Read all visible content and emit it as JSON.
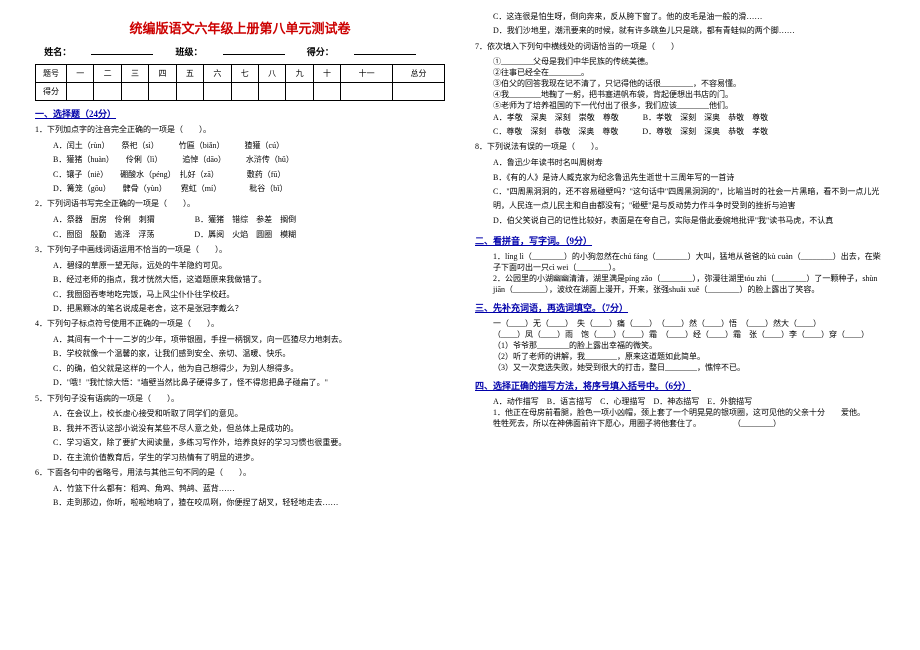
{
  "doc": {
    "title": "统编版语文六年级上册第八单元测试卷",
    "labels": {
      "name": "姓名：",
      "class": "班级：",
      "score": "得分："
    },
    "table": {
      "row1": [
        "题号",
        "一",
        "二",
        "三",
        "四",
        "五",
        "六",
        "七",
        "八",
        "九",
        "十",
        "十一",
        "总分"
      ],
      "row2_head": "得分"
    }
  },
  "s1": {
    "head": "一、选择题（24分）"
  },
  "q1": {
    "stem": "1．下列加点字的注音完全正确的一项是（　　）。",
    "a": "A．闰土（rùn）　　祭祀（sì）　　　竹匾（biǎn）　　　猹獾（cú）",
    "b": "B．獾猪（huàn）　　伶俐（lì）　　　追悼（dāo）　　　水浒传（hǔ）",
    "c": "C．镶子（niè）　　硼酸水（péng）　扎好（zā）　　　　敷药（fū）",
    "d": "D．篝笼（gōu）　　髀骨（yùn）　　 霓虹（mí）　　　　秕谷（bǐ）"
  },
  "q2": {
    "stem": "2．下列词语书写完全正确的一项是（　　）。",
    "a": "A．祭器　厨房　伶俐　刺猬",
    "b": "B．獾猪　错综　参差　搁倒",
    "c": "C．囫囵　殷勤　逃泽　浮荡",
    "d": "D．羼阅　火焰　圆圈　模糊"
  },
  "q3": {
    "stem": "3．下列句子中画线词语运用不恰当的一项是（　　）。",
    "a": "A．碧绿的草原一望无际，远处的牛羊隐约可见。",
    "b": "B．经过老师的指点，我才恍然大悟，这道题原来我做错了。",
    "c": "C．我囫囵吞枣地吃完饭，马上风尘仆仆往学校赶。",
    "d": "D．把黑颗冰的笔名说成是老舍，这不是张冠李戴么？"
  },
  "q4": {
    "stem": "4．下列句子标点符号使用不正确的一项是（　　）。",
    "a": "A．其间有一个十一二岁的少年，项带银圈，手捏一柄钢叉，向一匹猹尽力地刺去。",
    "b": "B．学校就像一个温馨的家，让我们感到安全、亲切、温暖、快乐。",
    "c": "C．的确，伯父就是这样的一个人，他为自己想得少，为别人想得多。",
    "d": "D．\"哦！\"我忙惊大悟：\"墙壁当然比鼻子硬得多了，怪不得您把鼻子碰扁了。\""
  },
  "q5": {
    "stem": "5．下列句子没有语病的一项是（　　）。",
    "a": "A．在会议上，校长虚心接受和听取了同学们的意见。",
    "b": "B．我并不否认这部小说没有某些不尽人意之处，但总体上是成功的。",
    "c": "C．学习语文，除了要扩大阅读量，多练习写作外，培养良好的学习习惯也很重要。",
    "d": "D．在主流价值教育后，学生的学习热情有了明显的进步。"
  },
  "q6": {
    "stem": "6．下面各句中的省略号，用法与其他三句不同的是（　　）。",
    "a": "A．竹篮下什么都有：稻鸡、角鸡、鹁鸪、蓝背……",
    "b": "B．走到那边，你听，啦啦地响了，猹在咬瓜咧，你便捏了胡叉，轻轻地走去……",
    "c": "C．这连很是怕生呀，倒向奔来，反从胯下窗了。他的皮毛是油一般的滑……",
    "d": "D．我们沙地里，潮汛要来的时候，就有许多跳鱼儿只是跳，都有青蛙似的两个脚……"
  },
  "q7": {
    "stem": "7．依次填入下列句中横线处的词语恰当的一项是（　　）",
    "l1": "①________父母是我们中华民族的传统美德。",
    "l2": "②往事已经全在________。",
    "l3": "③伯父的回答我现在记不清了，只记得他的话很________，不容易懂。",
    "l4": "④我________地鞠了一躬，把书塞进帆布袋，背起便想出书店的门。",
    "l5": "⑤老师为了培养祖国的下一代付出了很多，我们应该________他们。",
    "a": "A．孝敬　深奥　深刻　崇敬　尊敬",
    "b": "B．孝敬　深刻　深奥　恭敬　尊敬",
    "c": "C．尊敬　深刻　恭敬　深奥　尊敬",
    "d": "D．尊敬　深刻　深奥　恭敬　孝敬"
  },
  "q8": {
    "stem": "8．下列说法有误的一项是（　　）。",
    "a": "A．鲁迅少年读书时名叫周树寿",
    "b": "B．《有的人》是诗人臧克家为纪念鲁迅先生逝世十三周年写的一首诗",
    "c": "C．\"四周黑洞洞的，还不容易碰壁吗？\"这句话中\"四周黑洞洞的\"，比喻当时的社会一片黑暗，看不到一点儿光明，人民连一点儿民主和自由都没有；\"碰壁\"是与反动势力作斗争时受到的挫折与迫害",
    "d": "D．伯父笑说自己的记性比较好，表面是在夸自己，实际是借此委婉地批评\"我\"读书马虎，不认真"
  },
  "s2": {
    "head": "二、看拼音，写字词。（9分）"
  },
  "q9a": "1．líng lì（________）的小狗忽然在chú fáng（________）大叫，猛地从爸爸的kù cuàn（________）出去，在柴子下面叼出一只cì wei（________）。",
  "q9b": "2．公园里的小湖幽幽清清，湖里满是píng zǎo（________），弥漫往湖里tóu zhì（________）了一颗种子，shùn jiān（________），波纹在湖面上漫开，开来，张强shuǎi xuě（________）的脸上露出了笑容。",
  "s3": {
    "head": "三、先补充词语，再选词填空。（7分）"
  },
  "q10": {
    "l1": "一（____）无（____）　失（____）痛（____）　（____）然（____）悟　（____）然大（____）",
    "l2": "（____）凤（____）雨　饱（____）（____）霜　（____）经（____）霜　张（____）李（____）穿（____）",
    "l3a": "（1）爷爷那________的脸上露出幸福的微笑。",
    "l3b": "（2）听了老师的讲解，我________，原来这道题如此简单。",
    "l3c": "（3）又一次竞选失败，她受到很大的打击，整日________，憔悴不已。"
  },
  "s4": {
    "head": "四、选择正确的描写方法，将序号填入括号中。（6分）"
  },
  "q11": {
    "opts": "A．动作描写　B．语言描写　C．心理描写　D．神态描写　E．外貌描写",
    "l1": "1．他正在母房前看腿，脸色一项小凶帽，颈上套了一个明晃晃的银项圈，这可见他的父亲十分　　爱他。",
    "l2": "牲牲死去，所以在神佛面前许下愿心，用圈子将他套住了。　　　　　（________）"
  }
}
